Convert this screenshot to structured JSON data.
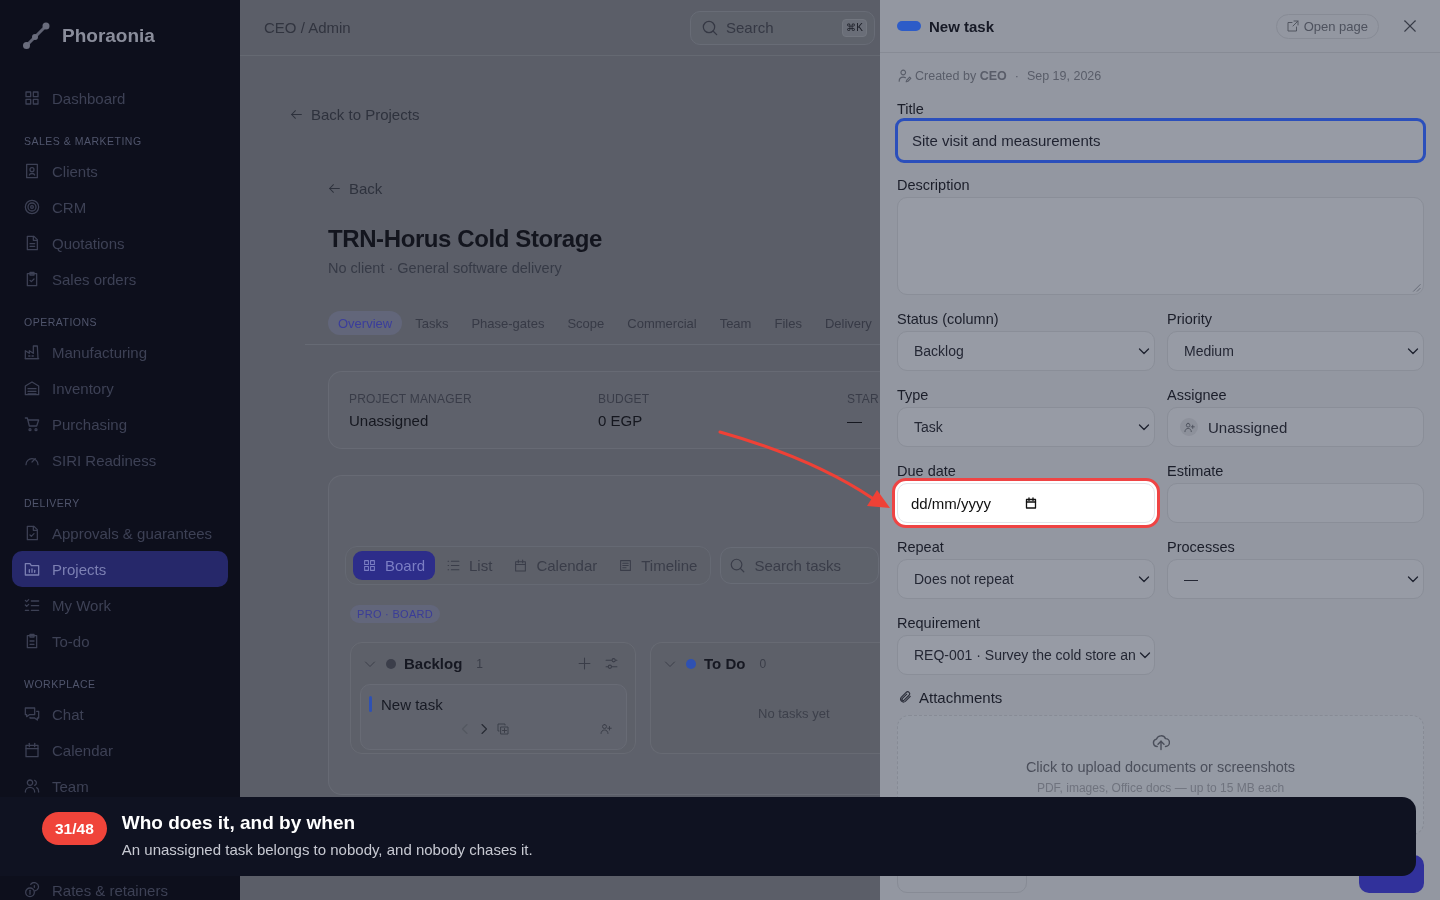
{
  "sidebar": {
    "brand": "Phoraonia",
    "groups": [
      {
        "items": [
          {
            "label": "Dashboard",
            "selected": false
          }
        ]
      },
      {
        "heading": "SALES & MARKETING",
        "items": [
          {
            "label": "Clients",
            "selected": false
          },
          {
            "label": "CRM",
            "selected": false
          },
          {
            "label": "Quotations",
            "selected": false
          },
          {
            "label": "Sales orders",
            "selected": false
          }
        ]
      },
      {
        "heading": "OPERATIONS",
        "items": [
          {
            "label": "Manufacturing",
            "selected": false
          },
          {
            "label": "Inventory",
            "selected": false
          },
          {
            "label": "Purchasing",
            "selected": false
          },
          {
            "label": "SIRI Readiness",
            "selected": false
          }
        ]
      },
      {
        "heading": "DELIVERY",
        "items": [
          {
            "label": "Approvals & guarantees",
            "selected": false
          },
          {
            "label": "Projects",
            "selected": true
          },
          {
            "label": "My Work",
            "selected": false
          },
          {
            "label": "To-do",
            "selected": false
          }
        ]
      },
      {
        "heading": "WORKPLACE",
        "items": [
          {
            "label": "Chat",
            "selected": false
          },
          {
            "label": "Calendar",
            "selected": false
          },
          {
            "label": "Team",
            "selected": false
          }
        ]
      }
    ],
    "bottom_items": [
      {
        "label": "Rates & retainers",
        "selected": false
      }
    ]
  },
  "header": {
    "breadcrumb": "CEO / Admin",
    "search": {
      "placeholder": "Search",
      "shortcut": "⌘K"
    }
  },
  "project": {
    "back_to_projects": "Back to Projects",
    "back": "Back",
    "title": "TRN-Horus Cold Storage",
    "subtitle": "No client · General software delivery",
    "tabs": [
      {
        "label": "Overview",
        "selected": true
      },
      {
        "label": "Tasks",
        "selected": false
      },
      {
        "label": "Phase-gates",
        "selected": false
      },
      {
        "label": "Scope",
        "selected": false
      },
      {
        "label": "Commercial",
        "selected": false
      },
      {
        "label": "Team",
        "selected": false
      },
      {
        "label": "Files",
        "selected": false
      },
      {
        "label": "Delivery",
        "selected": false
      }
    ],
    "summary": [
      {
        "label": "PROJECT MANAGER",
        "value": "Unassigned"
      },
      {
        "label": "BUDGET",
        "value": "0 EGP"
      },
      {
        "label": "STAR",
        "value": "—"
      }
    ]
  },
  "board": {
    "views": [
      {
        "label": "Board",
        "selected": true
      },
      {
        "label": "List",
        "selected": false
      },
      {
        "label": "Calendar",
        "selected": false
      },
      {
        "label": "Timeline",
        "selected": false
      }
    ],
    "search": {
      "placeholder": "Search tasks"
    },
    "badge": "PRO · BOARD",
    "columns": [
      {
        "name": "Backlog",
        "count": "1",
        "color": "#3b3e4a",
        "expanded": true,
        "actions": true,
        "cards": [
          {
            "title": "New task",
            "prev_disabled": true,
            "next_disabled": false
          }
        ]
      },
      {
        "name": "To Do",
        "count": "0",
        "color": "#2f51b2",
        "expanded": true,
        "actions": false,
        "empty_text": "No tasks yet"
      }
    ]
  },
  "drawer": {
    "title": "New task",
    "open_page": "Open page",
    "created": "Created by **CEO**",
    "separator": "·",
    "date": "Sep 19, 2026",
    "title_field": {
      "label": "Title",
      "value": "Site visit and measurements",
      "focused": true
    },
    "description": {
      "label": "Description"
    },
    "fields": [
      {
        "kind": "select",
        "label": "Status (column)",
        "value": "Backlog",
        "highlighted": false
      },
      {
        "kind": "select",
        "label": "Priority",
        "value": "Medium",
        "highlighted": false
      },
      {
        "kind": "select",
        "label": "Type",
        "value": "Task",
        "highlighted": false
      },
      {
        "kind": "picker",
        "label": "Assignee",
        "value": "Unassigned",
        "highlighted": false
      },
      {
        "kind": "date",
        "label": "Due date",
        "placeholder": "dd/mm/yyyy",
        "highlighted": true
      },
      {
        "kind": "text",
        "label": "Estimate",
        "highlighted": false
      },
      {
        "kind": "select",
        "label": "Repeat",
        "value": "Does not repeat",
        "highlighted": false
      },
      {
        "kind": "select",
        "label": "Processes",
        "value": "—",
        "highlighted": false
      },
      {
        "kind": "select",
        "label": "Requirement",
        "value": "REQ-001 · Survey the cold store an",
        "highlighted": false
      }
    ],
    "attachments": {
      "label": "Attachments",
      "dropzone_text": "Click to upload documents or screenshots",
      "dropzone_hint": "PDF, images, Office docs — up to 15 MB each"
    },
    "footer_buttons": [
      {
        "kind": "outline"
      },
      {
        "kind": "primary"
      }
    ]
  },
  "tour": {
    "step": "31/48",
    "title": "Who does it, and by when",
    "body": "An unassigned task belongs to nobody, and nobody chases it.",
    "pointer_arrow": true
  }
}
